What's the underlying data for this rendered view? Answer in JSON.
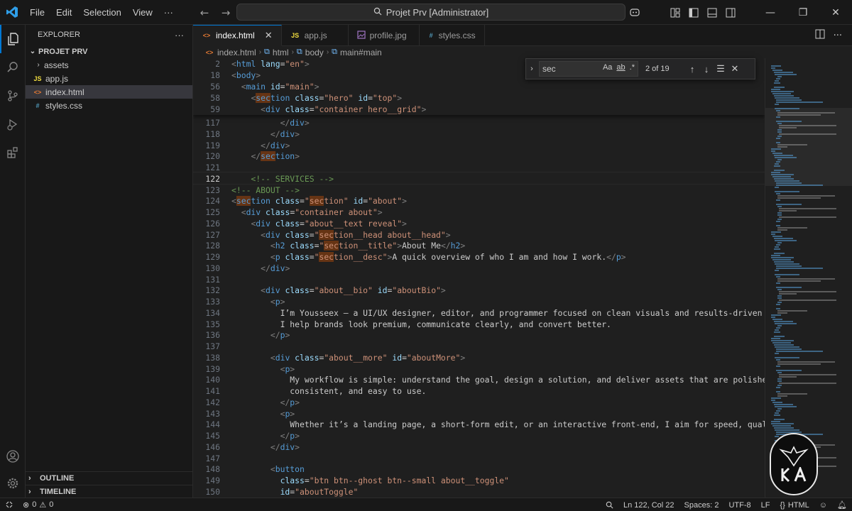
{
  "menu": [
    "File",
    "Edit",
    "Selection",
    "View"
  ],
  "command_center": "Projet Prv [Administrator]",
  "explorer": {
    "title": "EXPLORER",
    "root": "PROJET PRV",
    "items": [
      {
        "name": "assets",
        "type": "folder"
      },
      {
        "name": "app.js",
        "type": "js",
        "icon": "JS"
      },
      {
        "name": "index.html",
        "type": "html",
        "icon": "<>"
      },
      {
        "name": "styles.css",
        "type": "css",
        "icon": "#"
      }
    ],
    "outline": "OUTLINE",
    "timeline": "TIMELINE"
  },
  "tabs": [
    {
      "label": "index.html",
      "icon": "<>",
      "active": true
    },
    {
      "label": "app.js",
      "icon": "JS"
    },
    {
      "label": "profile.jpg",
      "icon": "image-icon"
    },
    {
      "label": "styles.css",
      "icon": "#"
    }
  ],
  "breadcrumb": [
    "index.html",
    "html",
    "body",
    "main#main"
  ],
  "find": {
    "query": "sec",
    "case_label": "Aa",
    "word_label": "ab",
    "regex_label": ".*",
    "count": "2 of 19"
  },
  "sticky_lines": [
    {
      "n": "2",
      "code": "<html lang=\"en\">"
    },
    {
      "n": "18",
      "code": "<body>"
    },
    {
      "n": "56",
      "code": "  <main id=\"main\">"
    },
    {
      "n": "58",
      "code": "    <section class=\"hero\" id=\"top\">"
    },
    {
      "n": "59",
      "code": "      <div class=\"container hero__grid\">"
    }
  ],
  "lines": [
    {
      "n": "117",
      "code": "          </div>"
    },
    {
      "n": "118",
      "code": "        </div>"
    },
    {
      "n": "119",
      "code": "      </div>"
    },
    {
      "n": "120",
      "code": "    </section>"
    },
    {
      "n": "121",
      "code": ""
    },
    {
      "n": "122",
      "code": "    <!-- SERVICES -->",
      "current": true
    },
    {
      "n": "123",
      "code": "<!-- ABOUT -->"
    },
    {
      "n": "124",
      "code": "<section class=\"section\" id=\"about\">"
    },
    {
      "n": "125",
      "code": "  <div class=\"container about\">"
    },
    {
      "n": "126",
      "code": "    <div class=\"about__text reveal\">"
    },
    {
      "n": "127",
      "code": "      <div class=\"section__head about__head\">"
    },
    {
      "n": "128",
      "code": "        <h2 class=\"section__title\">About Me</h2>"
    },
    {
      "n": "129",
      "code": "        <p class=\"section__desc\">A quick overview of who I am and how I work.</p>"
    },
    {
      "n": "130",
      "code": "      </div>"
    },
    {
      "n": "131",
      "code": ""
    },
    {
      "n": "132",
      "code": "      <div class=\"about__bio\" id=\"aboutBio\">"
    },
    {
      "n": "133",
      "code": "        <p>"
    },
    {
      "n": "134",
      "code": "          I’m Yousseex — a UI/UX designer, editor, and programmer focused on clean visuals and results-driven experiences."
    },
    {
      "n": "135",
      "code": "          I help brands look premium, communicate clearly, and convert better."
    },
    {
      "n": "136",
      "code": "        </p>"
    },
    {
      "n": "137",
      "code": ""
    },
    {
      "n": "138",
      "code": "        <div class=\"about__more\" id=\"aboutMore\">"
    },
    {
      "n": "139",
      "code": "          <p>"
    },
    {
      "n": "140",
      "code": "            My workflow is simple: understand the goal, design a solution, and deliver assets that are polished,"
    },
    {
      "n": "141",
      "code": "            consistent, and easy to use."
    },
    {
      "n": "142",
      "code": "          </p>"
    },
    {
      "n": "143",
      "code": "          <p>"
    },
    {
      "n": "144",
      "code": "            Whether it’s a landing page, a short-form edit, or an interactive front-end, I aim for speed, quality, and reliab"
    },
    {
      "n": "145",
      "code": "          </p>"
    },
    {
      "n": "146",
      "code": "        </div>"
    },
    {
      "n": "147",
      "code": ""
    },
    {
      "n": "148",
      "code": "        <button"
    },
    {
      "n": "149",
      "code": "          class=\"btn btn--ghost btn--small about__toggle\""
    },
    {
      "n": "150",
      "code": "          id=\"aboutToggle\""
    }
  ],
  "status": {
    "errors": "0",
    "warnings": "0",
    "position": "Ln 122, Col 22",
    "spaces": "Spaces: 2",
    "encoding": "UTF-8",
    "eol": "LF",
    "language": "HTML"
  },
  "colors": {
    "tag": "#569cd6",
    "attr": "#9cdcfe",
    "string": "#ce9178",
    "comment": "#6a9955",
    "accent": "#0078d4"
  }
}
